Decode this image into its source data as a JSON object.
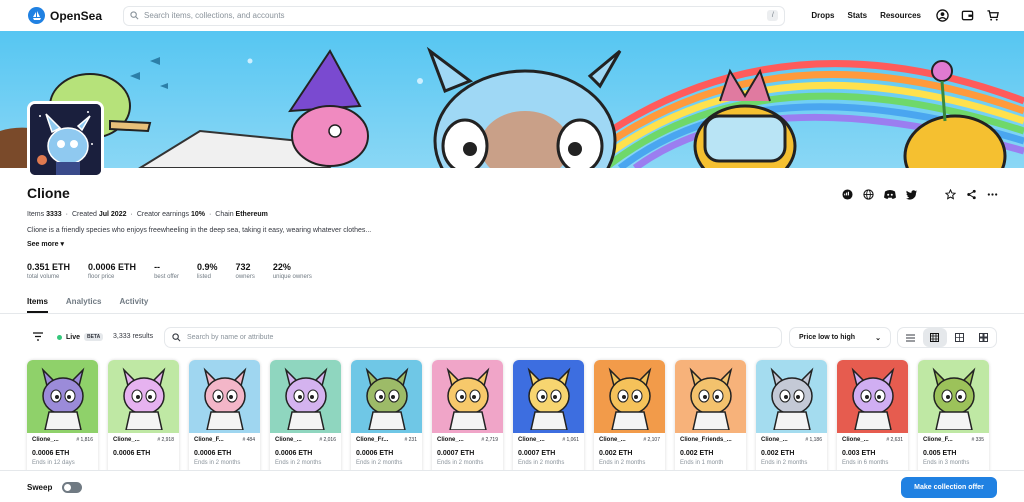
{
  "nav": {
    "brand": "OpenSea",
    "search_placeholder": "Search items, collections, and accounts",
    "search_shortcut": "/",
    "links": [
      "Drops",
      "Stats",
      "Resources"
    ]
  },
  "collection": {
    "name": "Clione",
    "meta": {
      "items_label": "Items",
      "items_value": "3333",
      "created_label": "Created",
      "created_value": "Jul 2022",
      "earnings_label": "Creator earnings",
      "earnings_value": "10%",
      "chain_label": "Chain",
      "chain_value": "Ethereum"
    },
    "description": "Clione is a friendly species who enjoys freewheeling in the deep sea, taking it easy, wearing whatever clothes...",
    "see_more": "See more",
    "stats": [
      {
        "value": "0.351 ETH",
        "label": "total volume"
      },
      {
        "value": "0.0006 ETH",
        "label": "floor price"
      },
      {
        "value": "--",
        "label": "best offer"
      },
      {
        "value": "0.9%",
        "label": "listed"
      },
      {
        "value": "732",
        "label": "owners"
      },
      {
        "value": "22%",
        "label": "unique owners"
      }
    ]
  },
  "tabs": [
    {
      "label": "Items",
      "active": true
    },
    {
      "label": "Analytics",
      "active": false
    },
    {
      "label": "Activity",
      "active": false
    }
  ],
  "filterbar": {
    "live_label": "Live",
    "beta_label": "BETA",
    "results": "3,333 results",
    "search_placeholder": "Search by name or attribute",
    "sort_label": "Price low to high"
  },
  "items": [
    {
      "name": "Clione_...",
      "rank": "# 1,816",
      "price": "0.0006 ETH",
      "ends": "Ends in 12 days",
      "bg": "#8fd16a",
      "face": "#9b8bd9"
    },
    {
      "name": "Clione_...",
      "rank": "# 2,918",
      "price": "0.0006 ETH",
      "ends": "",
      "bg": "#bfe8a4",
      "face": "#e6b2f0"
    },
    {
      "name": "Clione_F...",
      "rank": "# 484",
      "price": "0.0006 ETH",
      "ends": "Ends in 2 months",
      "bg": "#9fd6f0",
      "face": "#f3b6c8"
    },
    {
      "name": "Clione_...",
      "rank": "# 2,016",
      "price": "0.0006 ETH",
      "ends": "Ends in 2 months",
      "bg": "#8fd6bf",
      "face": "#d4b3ef"
    },
    {
      "name": "Clione_Fr...",
      "rank": "# 231",
      "price": "0.0006 ETH",
      "ends": "Ends in 2 months",
      "bg": "#6fc7e6",
      "face": "#9dbb68"
    },
    {
      "name": "Clione_...",
      "rank": "# 2,719",
      "price": "0.0007 ETH",
      "ends": "Ends in 2 months",
      "bg": "#f0a5c8",
      "face": "#f7c96b"
    },
    {
      "name": "Clione_...",
      "rank": "# 1,061",
      "price": "0.0007 ETH",
      "ends": "Ends in 2 months",
      "bg": "#3d6ee0",
      "face": "#f7d570"
    },
    {
      "name": "Clione_...",
      "rank": "# 2,107",
      "price": "0.002 ETH",
      "ends": "Ends in 2 months",
      "bg": "#f29b4a",
      "face": "#f5c25a"
    },
    {
      "name": "Clione_Friends_...",
      "rank": "",
      "price": "0.002 ETH",
      "ends": "Ends in 1 month",
      "bg": "#f7b27a",
      "face": "#f3c26d"
    },
    {
      "name": "Clione_...",
      "rank": "# 1,186",
      "price": "0.002 ETH",
      "ends": "Ends in 2 months",
      "bg": "#a4dcef",
      "face": "#c4c9d6"
    },
    {
      "name": "Clione_...",
      "rank": "# 2,631",
      "price": "0.003 ETH",
      "ends": "Ends in 6 months",
      "bg": "#e65c4f",
      "face": "#d0aef2"
    },
    {
      "name": "Clione_F...",
      "rank": "# 335",
      "price": "0.005 ETH",
      "ends": "Ends in 3 months",
      "bg": "#bfe8a4",
      "face": "#9cc25a"
    }
  ],
  "footer": {
    "sweep_label": "Sweep",
    "offer_button": "Make collection offer"
  },
  "colors": {
    "accent": "#2081e2",
    "live": "#34c77b"
  }
}
